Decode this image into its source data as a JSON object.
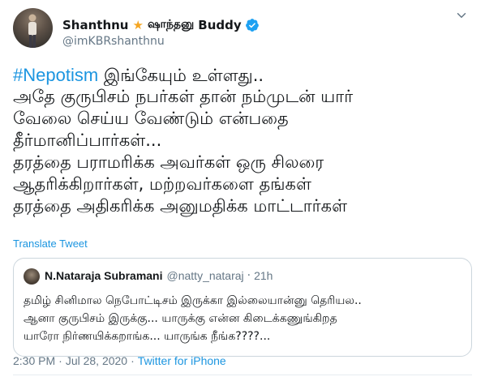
{
  "author": {
    "display_name": "Shanthnu",
    "tamil_name": "ஷாந்தனு",
    "suffix": "Buddy",
    "handle": "@imKBRshanthnu",
    "star_glyph": "★"
  },
  "tweet": {
    "hashtag": "#Nepotism",
    "lines": [
      " இங்கேயும் உள்ளது..",
      "அதே குருபிசம் நபர்கள் தான் நம்முடன் யார்",
      "வேலை செய்ய வேண்டும் என்பதை",
      "தீர்மானிப்பார்கள்...",
      "தரத்தை பராமரிக்க அவர்கள் ஒரு சிலரை",
      "ஆதரிக்கிறார்கள், மற்றவர்களை தங்கள்",
      "தரத்தை அதிகரிக்க அனுமதிக்க மாட்டார்கள்"
    ],
    "translate_label": "Translate Tweet"
  },
  "quoted_tweet": {
    "name": "N.Nataraja Subramani",
    "handle": "@natty_nataraj",
    "separator": "·",
    "time": "21h",
    "lines": [
      "தமிழ் சினிமால நெபோட்டிசம் இருக்கா இல்லையான்னு தெரியல..",
      "ஆனா குருபிசம் இருக்கு... யாருக்கு என்ன கிடைக்கணுங்கிறத",
      "யாரோ நிர்ணயிக்கறாங்க... யாருங்க நீங்க????..."
    ]
  },
  "meta": {
    "time": "2:30 PM",
    "separator": "·",
    "date": "Jul 28, 2020",
    "source": "Twitter for iPhone"
  },
  "colors": {
    "link": "#1b95e0",
    "secondary_text": "#657786",
    "verified": "#1da1f2",
    "star": "#f5a623"
  }
}
